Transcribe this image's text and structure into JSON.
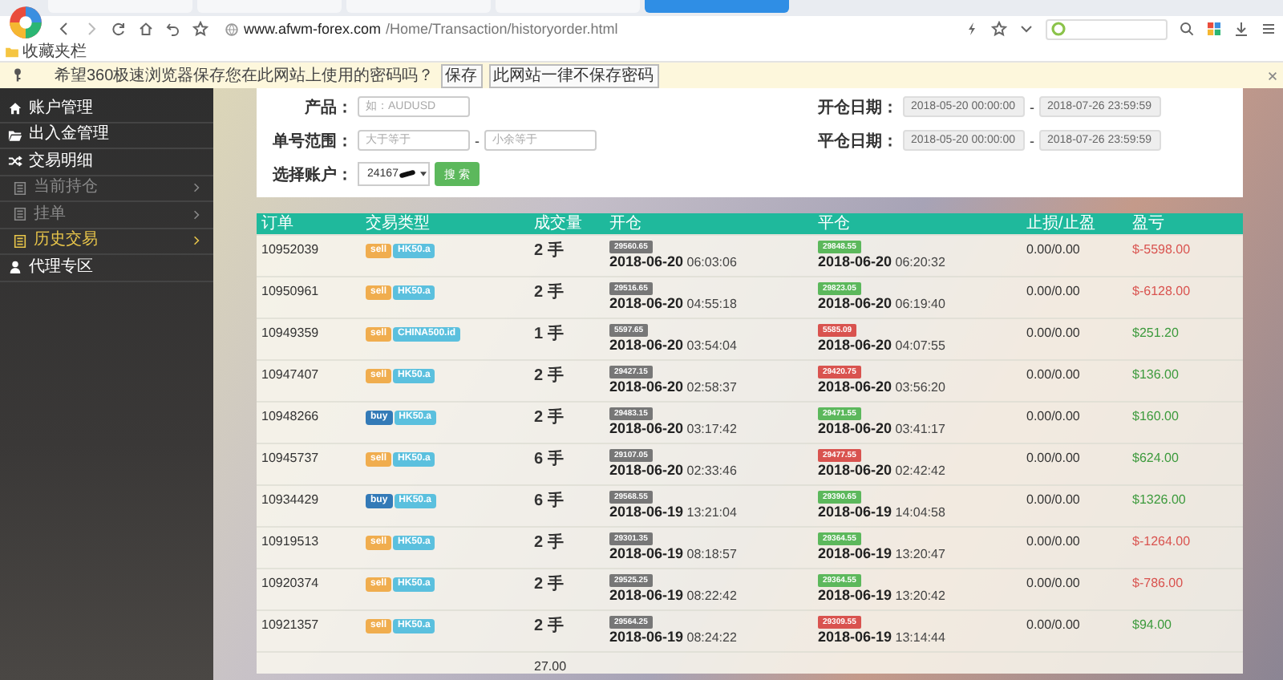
{
  "browser": {
    "tabs": [
      {
        "selected": false
      },
      {
        "selected": false
      },
      {
        "selected": false
      },
      {
        "selected": false
      },
      {
        "selected": true
      }
    ],
    "url_host": "www.afwm-forex.com",
    "url_path": "/Home/Transaction/historyorder.html",
    "bookmarks_label": "收藏夹栏",
    "password_bar": {
      "message": "希望360极速浏览器保存您在此网站上使用的密码吗？",
      "buttons": [
        "保存",
        "此网站一律不保存密码"
      ]
    }
  },
  "sidebar": {
    "items": [
      {
        "kind": "main",
        "label": "账户管理",
        "selected": false
      },
      {
        "kind": "main",
        "label": "出入金管理",
        "selected": false
      },
      {
        "kind": "main",
        "label": "交易明细",
        "selected": false
      },
      {
        "kind": "sub",
        "label": "当前持仓",
        "selected": false
      },
      {
        "kind": "sub",
        "label": "挂单",
        "selected": false
      },
      {
        "kind": "sub",
        "label": "历史交易",
        "selected": true
      },
      {
        "kind": "main",
        "label": "代理专区",
        "selected": false
      }
    ]
  },
  "filters": {
    "product": {
      "label": "产品：",
      "placeholder": "如：AUDUSD"
    },
    "order_range": {
      "label": "单号范围：",
      "from_placeholder": "大于等于",
      "separator": "-",
      "to_placeholder": "小余等于"
    },
    "account": {
      "label": "选择账户：",
      "value": "24167",
      "button": "搜 索"
    },
    "open_date": {
      "label": "开仓日期：",
      "from": "2018-05-20 00:00:00",
      "separator": "-",
      "to": "2018-07-26 23:59:59"
    },
    "close_date": {
      "label": "平仓日期：",
      "from": "2018-05-20 00:00:00",
      "separator": "-",
      "to": "2018-07-26 23:59:59"
    }
  },
  "table": {
    "columns": [
      "订单",
      "交易类型",
      "成交量",
      "开仓",
      "平仓",
      "止损/止盈",
      "盈亏"
    ],
    "rows": [
      {
        "order": "10952039",
        "kind": "sell",
        "side": "sell",
        "symbol": "HK50.a",
        "volume": "2 手",
        "open": {
          "price": "29560.65",
          "datetime": "**2018-06-20** 06:03:06"
        },
        "close": {
          "price": "29848.55",
          "datetime": "**2018-06-20** 06:20:32",
          "color": "#5cb85c"
        },
        "sl_tp": "0.00/0.00",
        "profit": {
          "text": "$-5598.00",
          "color": "#d9534f"
        }
      },
      {
        "order": "10950961",
        "kind": "sell",
        "side": "sell",
        "symbol": "HK50.a",
        "volume": "2 手",
        "open": {
          "price": "29516.65",
          "datetime": "**2018-06-20** 04:55:18"
        },
        "close": {
          "price": "29823.05",
          "datetime": "**2018-06-20** 06:19:40",
          "color": "#5cb85c"
        },
        "sl_tp": "0.00/0.00",
        "profit": {
          "text": "$-6128.00",
          "color": "#d9534f"
        }
      },
      {
        "order": "10949359",
        "kind": "sell",
        "side": "sell",
        "symbol": "CHINA500.id",
        "volume": "1 手",
        "open": {
          "price": "5597.65",
          "datetime": "**2018-06-20** 03:54:04"
        },
        "close": {
          "price": "5585.09",
          "datetime": "**2018-06-20** 04:07:55",
          "color": "#d9534f"
        },
        "sl_tp": "0.00/0.00",
        "profit": {
          "text": "$251.20",
          "color": "#3c9a3c"
        }
      },
      {
        "order": "10947407",
        "kind": "sell",
        "side": "sell",
        "symbol": "HK50.a",
        "volume": "2 手",
        "open": {
          "price": "29427.15",
          "datetime": "**2018-06-20** 02:58:37"
        },
        "close": {
          "price": "29420.75",
          "datetime": "**2018-06-20** 03:56:20",
          "color": "#d9534f"
        },
        "sl_tp": "0.00/0.00",
        "profit": {
          "text": "$136.00",
          "color": "#3c9a3c"
        }
      },
      {
        "order": "10948266",
        "kind": "buy",
        "side": "buy",
        "symbol": "HK50.a",
        "volume": "2 手",
        "open": {
          "price": "29483.15",
          "datetime": "**2018-06-20** 03:17:42"
        },
        "close": {
          "price": "29471.55",
          "datetime": "**2018-06-20** 03:41:17",
          "color": "#5cb85c"
        },
        "sl_tp": "0.00/0.00",
        "profit": {
          "text": "$160.00",
          "color": "#3c9a3c"
        }
      },
      {
        "order": "10945737",
        "kind": "sell",
        "side": "sell",
        "symbol": "HK50.a",
        "volume": "6 手",
        "open": {
          "price": "29107.05",
          "datetime": "**2018-06-20** 02:33:46"
        },
        "close": {
          "price": "29477.55",
          "datetime": "**2018-06-20** 02:42:42",
          "color": "#d9534f"
        },
        "sl_tp": "0.00/0.00",
        "profit": {
          "text": "$624.00",
          "color": "#3c9a3c"
        }
      },
      {
        "order": "10934429",
        "kind": "buy",
        "side": "buy",
        "symbol": "HK50.a",
        "volume": "6 手",
        "open": {
          "price": "29568.55",
          "datetime": "**2018-06-19** 13:21:04"
        },
        "close": {
          "price": "29390.65",
          "datetime": "**2018-06-19** 14:04:58",
          "color": "#5cb85c"
        },
        "sl_tp": "0.00/0.00",
        "profit": {
          "text": "$1326.00",
          "color": "#3c9a3c"
        }
      },
      {
        "order": "10919513",
        "kind": "sell",
        "side": "sell",
        "symbol": "HK50.a",
        "volume": "2 手",
        "open": {
          "price": "29301.35",
          "datetime": "**2018-06-19** 08:18:57"
        },
        "close": {
          "price": "29364.55",
          "datetime": "**2018-06-19** 13:20:47",
          "color": "#5cb85c"
        },
        "sl_tp": "0.00/0.00",
        "profit": {
          "text": "$-1264.00",
          "color": "#d9534f"
        }
      },
      {
        "order": "10920374",
        "kind": "sell",
        "side": "sell",
        "symbol": "HK50.a",
        "volume": "2 手",
        "open": {
          "price": "29525.25",
          "datetime": "**2018-06-19** 08:22:42"
        },
        "close": {
          "price": "29364.55",
          "datetime": "**2018-06-19** 13:20:42",
          "color": "#5cb85c"
        },
        "sl_tp": "0.00/0.00",
        "profit": {
          "text": "$-786.00",
          "color": "#d9534f"
        }
      },
      {
        "order": "10921357",
        "kind": "sell",
        "side": "sell",
        "symbol": "HK50.a",
        "volume": "2 手",
        "open": {
          "price": "29564.25",
          "datetime": "**2018-06-19** 08:24:22"
        },
        "close": {
          "price": "29309.55",
          "datetime": "**2018-06-19** 13:14:44",
          "color": "#d9534f"
        },
        "sl_tp": "0.00/0.00",
        "profit": {
          "text": "$94.00",
          "color": "#3c9a3c"
        }
      }
    ],
    "total_volume": "27.00"
  }
}
